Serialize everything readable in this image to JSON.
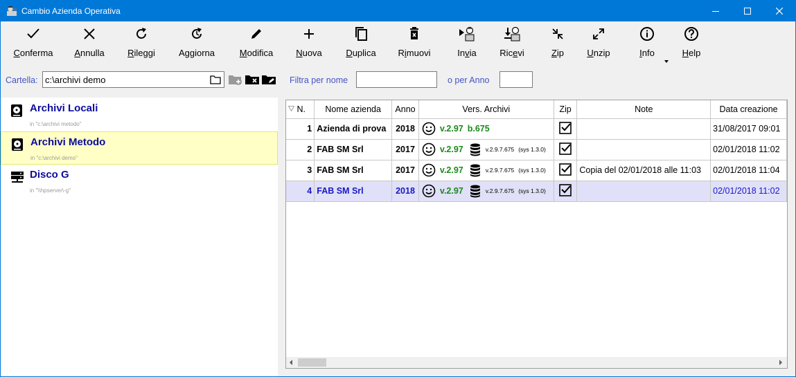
{
  "window": {
    "title": "Cambio Azienda Operativa"
  },
  "colors": {
    "titlebar": "#0078d7",
    "accent_text": "#0c0c9c",
    "selected_row": "#e0e0f8",
    "selected_archive": "#ffffc6",
    "version_green": "#1a8a1a",
    "label_blue": "#4454c4"
  },
  "toolbar": [
    {
      "label": "Conferma",
      "underline": "C",
      "rest": "onferma",
      "icon": "check-icon"
    },
    {
      "label": "Annulla",
      "underline": "A",
      "rest": "nnulla",
      "icon": "x-icon"
    },
    {
      "label": "Rileggi",
      "underline": "R",
      "rest": "ileggi",
      "icon": "refresh-icon"
    },
    {
      "label": "Aggiorna",
      "underline": "",
      "rest": "Aggiorna",
      "icon": "update-icon"
    },
    {
      "label": "Modifica",
      "underline": "M",
      "rest": "odifica",
      "icon": "pencil-icon"
    },
    {
      "label": "Nuova",
      "underline": "N",
      "rest": "uova",
      "icon": "plus-icon"
    },
    {
      "label": "Duplica",
      "underline": "D",
      "rest": "uplica",
      "icon": "copy-icon"
    },
    {
      "label": "Rimuovi",
      "pre": "R",
      "underline": "i",
      "rest": "muovi",
      "icon": "trash-icon"
    },
    {
      "label": "Invia",
      "pre": "In",
      "underline": "v",
      "rest": "ia",
      "icon": "send-icon"
    },
    {
      "label": "Ricevi",
      "pre": "Ric",
      "underline": "e",
      "rest": "vi",
      "icon": "receive-icon"
    },
    {
      "label": "Zip",
      "underline": "Z",
      "rest": "ip",
      "icon": "compress-icon"
    },
    {
      "label": "Unzip",
      "underline": "U",
      "rest": "nzip",
      "icon": "expand-icon"
    },
    {
      "label": "Info",
      "underline": "I",
      "rest": "nfo",
      "icon": "info-icon"
    },
    {
      "label": "Help",
      "underline": "H",
      "rest": "elp",
      "icon": "help-icon"
    }
  ],
  "folder": {
    "label": "Cartella:",
    "path": "c:\\archivi demo",
    "filter_name_label": "Filtra per nome",
    "filter_name_value": "",
    "filter_year_label": "o per Anno",
    "filter_year_value": ""
  },
  "archives": [
    {
      "name": "Archivi Locali",
      "path": "in \"c:\\archivi metodo\"",
      "selected": false,
      "icon": "drive-icon"
    },
    {
      "name": "Archivi Metodo",
      "path": "in \"c:\\archivi demo\"",
      "selected": true,
      "icon": "drive-icon"
    },
    {
      "name": "Disco G",
      "path": "in \"\\\\hpserver\\-g\"",
      "selected": false,
      "icon": "server-icon"
    }
  ],
  "grid": {
    "columns": [
      "N.",
      "Nome azienda",
      "Anno",
      "Vers. Archivi",
      "Zip",
      "Note",
      "Data creazione"
    ],
    "rows": [
      {
        "n": "1",
        "name": "Azienda di prova",
        "year": "2018",
        "ver": "v.2.97",
        "build": "b.675",
        "db": "",
        "sys": "",
        "zip": true,
        "note": "",
        "date": "31/08/2017 09:01",
        "selected": false
      },
      {
        "n": "2",
        "name": "FAB SM Srl",
        "year": "2017",
        "ver": "v.2.97",
        "build": "",
        "db": "v.2.9.7.675",
        "sys": "(sys 1.3.0)",
        "zip": true,
        "note": "",
        "date": "02/01/2018 11:02",
        "selected": false
      },
      {
        "n": "3",
        "name": "FAB SM Srl",
        "year": "2017",
        "ver": "v.2.97",
        "build": "",
        "db": "v.2.9.7.675",
        "sys": "(sys 1.3.0)",
        "zip": true,
        "note": "Copia del 02/01/2018 alle 11:03",
        "date": "02/01/2018 11:04",
        "selected": false
      },
      {
        "n": "4",
        "name": "FAB SM Srl",
        "year": "2018",
        "ver": "v.2.97",
        "build": "",
        "db": "v.2.9.7.675",
        "sys": "(sys 1.3.0)",
        "zip": true,
        "note": "",
        "date": "02/01/2018 11:02",
        "selected": true
      }
    ]
  }
}
